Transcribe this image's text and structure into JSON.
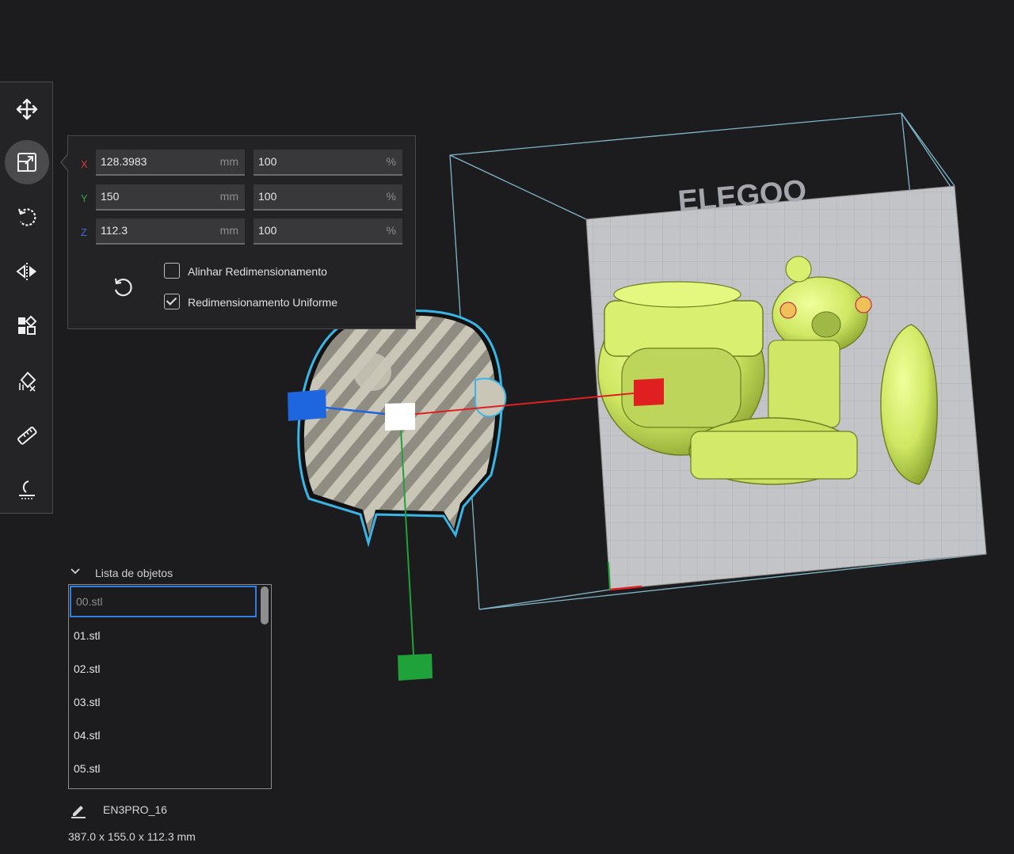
{
  "toolbar": {
    "tools": [
      {
        "icon": "move-icon",
        "active": false
      },
      {
        "icon": "scale-icon",
        "active": true
      },
      {
        "icon": "rotate-icon",
        "active": false
      },
      {
        "icon": "mirror-icon",
        "active": false
      },
      {
        "icon": "arrange-icon",
        "active": false
      },
      {
        "icon": "supports-icon",
        "active": false
      },
      {
        "icon": "measure-icon",
        "active": false
      },
      {
        "icon": "lay-flat-icon",
        "active": false
      }
    ]
  },
  "scale_panel": {
    "rows": [
      {
        "axis": "X",
        "axis_color": "#d83b3b",
        "size": "128.3983",
        "size_unit": "mm",
        "percent": "100",
        "percent_unit": "%"
      },
      {
        "axis": "Y",
        "axis_color": "#2fa84f",
        "size": "150",
        "size_unit": "mm",
        "percent": "100",
        "percent_unit": "%"
      },
      {
        "axis": "Z",
        "axis_color": "#3a6fd8",
        "size": "112.3",
        "size_unit": "mm",
        "percent": "100",
        "percent_unit": "%"
      }
    ],
    "reset_icon": "reset-icon",
    "options": [
      {
        "label": "Alinhar Redimensionamento",
        "checked": false
      },
      {
        "label": "Redimensionamento Uniforme",
        "checked": true
      }
    ]
  },
  "build_plate": {
    "brand": "ELEGOO"
  },
  "object_list": {
    "title": "Lista de objetos",
    "items": [
      "00.stl",
      "01.stl",
      "02.stl",
      "03.stl",
      "04.stl",
      "05.stl"
    ],
    "selected_index": 0
  },
  "footer": {
    "printer_name": "EN3PRO_16",
    "dimensions": "387.0 x 155.0 x 112.3 mm"
  },
  "colors": {
    "model_green": "#d4ec6a",
    "gizmo_x": "#e02020",
    "gizmo_y": "#1fa23a",
    "gizmo_z": "#1d66e0",
    "selection_outline": "#3ab6e6"
  }
}
